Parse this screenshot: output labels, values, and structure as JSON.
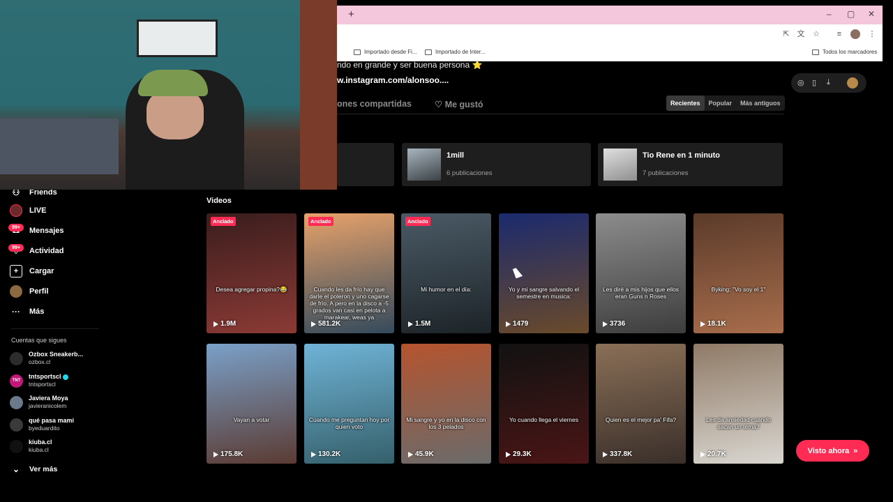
{
  "browser": {
    "new_tab_symbol": "+",
    "window_controls": [
      "–",
      "▢",
      "✕"
    ],
    "bookmarks": [
      "Importado desde Fi...",
      "Importado de Inter...",
      "Todos los marcadores"
    ]
  },
  "profile": {
    "bio_line": "ndo en grande y ser buena persona ⭐",
    "link": "w.instagram.com/alonsoo....",
    "tabs": [
      {
        "label": "ones compartidas"
      },
      {
        "label": "Me gustó",
        "icon": "heart-outline-icon"
      }
    ],
    "sort_options": [
      {
        "label": "Recientes",
        "active": true
      },
      {
        "label": "Popular",
        "active": false
      },
      {
        "label": "Más antiguos",
        "active": false
      }
    ]
  },
  "playlists": [
    {
      "name": "1mill",
      "count": "6 publicaciones"
    },
    {
      "name": "Tio Rene en 1 minuto",
      "count": "7 publicaciones"
    }
  ],
  "sidebar": {
    "nav": [
      {
        "label": "Friends",
        "icon": "friends-icon"
      },
      {
        "label": "LIVE",
        "icon": "live-icon"
      },
      {
        "label": "Mensajes",
        "icon": "messages-icon",
        "badge": "99+"
      },
      {
        "label": "Actividad",
        "icon": "activity-icon",
        "badge": "99+"
      },
      {
        "label": "Cargar",
        "icon": "upload-icon"
      },
      {
        "label": "Perfil",
        "icon": "profile-avatar-icon"
      },
      {
        "label": "Más",
        "icon": "more-dots-icon"
      }
    ],
    "following_title": "Cuentas que sigues",
    "following": [
      {
        "name": "Ozbox Sneakerb...",
        "user": "ozbox.cl",
        "avatar": ""
      },
      {
        "name": "tntsportscl",
        "user": "tntsportscl",
        "avatar": "TNT",
        "verified": true
      },
      {
        "name": "Javiera Moya",
        "user": "javieranicolem",
        "avatar": ""
      },
      {
        "name": "qué pasa mami",
        "user": "byeduardito",
        "avatar": ""
      },
      {
        "name": "kiuba.cl",
        "user": "kiuba.cl",
        "avatar": ""
      }
    ],
    "see_more": "Ver más"
  },
  "videos": {
    "title": "Videos",
    "items": [
      {
        "pinned": "Anclado",
        "caption": "Desea agregar propina?😂",
        "views": "1.9M",
        "colors": [
          "#3a1d1d",
          "#8b3a35"
        ]
      },
      {
        "pinned": "Anclado",
        "caption": "Cuando les da frío hay que darle el poleron y uno cagarse de frío. A pero en la disco a -5 grados van casi en pelota a marakear, weas ya",
        "views": "581.2K",
        "colors": [
          "#e7a26a",
          "#344a5c"
        ]
      },
      {
        "pinned": "Anclado",
        "caption": "Mi humor en el día:",
        "views": "1.5M",
        "colors": [
          "#4a5a66",
          "#1d2428"
        ]
      },
      {
        "pinned": "",
        "caption": "Yo y mi sangre salvando el semestre en musica:",
        "views": "1479",
        "colors": [
          "#1b2a6e",
          "#6a4a2a"
        ]
      },
      {
        "pinned": "",
        "caption": "Les diré a mis hijos que ellos eran Guns n Roses",
        "views": "3736",
        "colors": [
          "#8c8c8c",
          "#3d3d3d"
        ]
      },
      {
        "pinned": "",
        "caption": "Byking: \"Vo soy el 1\"",
        "views": "18.1K",
        "colors": [
          "#5b3b2a",
          "#a86d4c"
        ]
      },
      {
        "pinned": "",
        "caption": "Vayan a votar",
        "views": "175.8K",
        "colors": [
          "#7aa0c8",
          "#5b3b33"
        ]
      },
      {
        "pinned": "",
        "caption": "Cuando me preguntan hoy por quien voto",
        "views": "130.2K",
        "colors": [
          "#6fb3d6",
          "#35606b"
        ]
      },
      {
        "pinned": "",
        "caption": "Mi sangre y yo en la disco con los 3 pelados",
        "views": "45.9K",
        "colors": [
          "#b5542e",
          "#6b6b6b"
        ]
      },
      {
        "pinned": "",
        "caption": "Yo cuando llega el viernes",
        "views": "29.3K",
        "colors": [
          "#121212",
          "#4a1515"
        ]
      },
      {
        "pinned": "",
        "caption": "Quien es el mejor pa' Fifa?",
        "views": "337.8K",
        "colors": [
          "#8a6f57",
          "#3a2f2a"
        ]
      },
      {
        "pinned": "",
        "caption": "Les da ansiedad cuando sacan un tema?",
        "views": "20.7K",
        "colors": [
          "#8f7a66",
          "#d9d6d0"
        ]
      }
    ]
  },
  "watched_button": {
    "label": "Visto ahora",
    "icon": "chevron-double-down-icon"
  }
}
